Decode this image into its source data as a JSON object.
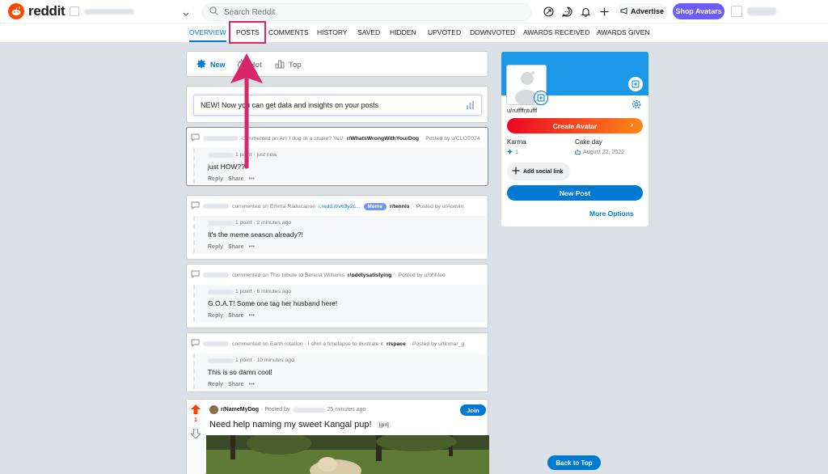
{
  "brand": {
    "name": "reddit"
  },
  "header": {
    "search_placeholder": "Search Reddit",
    "advertise_label": "Advertise",
    "shop_avatars_label": "Shop Avatars"
  },
  "tabs": [
    {
      "label": "OVERVIEW",
      "active": true
    },
    {
      "label": "POSTS"
    },
    {
      "label": "COMMENTS"
    },
    {
      "label": "HISTORY"
    },
    {
      "label": "SAVED"
    },
    {
      "label": "HIDDEN"
    },
    {
      "label": "UPVOTED"
    },
    {
      "label": "DOWNVOTED"
    },
    {
      "label": "AWARDS RECEIVED"
    },
    {
      "label": "AWARDS GIVEN"
    }
  ],
  "sort": {
    "new": "New",
    "hot": "Hot",
    "top": "Top"
  },
  "promo": {
    "text": "NEW! Now you can get data and insights on your posts"
  },
  "comments": [
    {
      "header_text": "commented on Am I dog or a snake? Yes!",
      "subreddit": "r/WhatsWrongWithYourDog",
      "posted_by": "· Posted by u/CLOT074",
      "meta": "1 point · just now",
      "text": "just HOW???"
    },
    {
      "header_text": "commented on Emma Raducanoe",
      "link": "i.redd.it/v63y2c...",
      "flair": "Meme",
      "subreddit": "r/tennis",
      "posted_by": "· Posted by u/Aomiin",
      "meta": "1 point · 2 minutes ago",
      "text": "It's the meme season already?!"
    },
    {
      "header_text": "commented on This tribute to Serena Williams",
      "subreddit": "r/oddlysatisfying",
      "posted_by": "· Posted by u/ohhleo",
      "meta": "1 point · 6 minutes ago",
      "text": "G.O.A.T! Some one tag her husband here!"
    },
    {
      "header_text": "commented on Earth rotation - I shot a timelapse to illustrate it",
      "subreddit": "r/space",
      "posted_by": "· Posted by u/tinmar_g",
      "meta": "1 point · 10 minutes ago",
      "text": "This is so damn cool!"
    }
  ],
  "comment_actions": {
    "reply": "Reply",
    "share": "Share",
    "more": "•••"
  },
  "post": {
    "subreddit": "r/NameMyDog",
    "posted_by": "· Posted by",
    "time": "25 minutes ago",
    "join_label": "Join",
    "title": "Need help naming my sweet Kangal pup!",
    "flair": "[girl]",
    "votes": "1"
  },
  "profile": {
    "username": "u/ruffffntufff",
    "create_avatar": "Create Avatar",
    "karma_label": "Karma",
    "karma_value": "1",
    "cakeday_label": "Cake day",
    "cakeday_value": "August 22, 2022",
    "add_social": "Add social link",
    "new_post": "New Post",
    "more_options": "More Options"
  },
  "back_to_top": "Back to Top",
  "colors": {
    "brand": "#ff4500",
    "accent": "#0079d3",
    "highlight": "#d9266b"
  }
}
